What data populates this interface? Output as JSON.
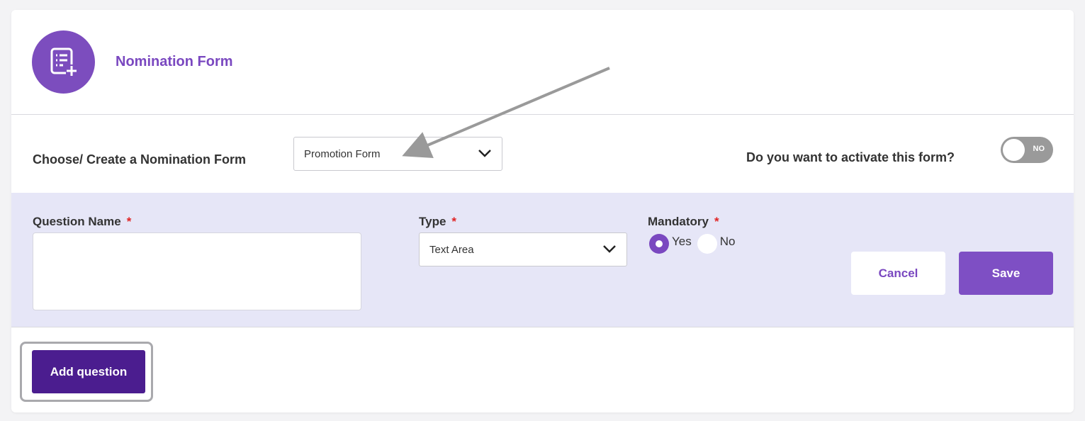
{
  "header": {
    "title": "Nomination Form",
    "icon": "form-add-icon"
  },
  "choose": {
    "label": "Choose/ Create a Nomination Form",
    "selected": "Promotion Form"
  },
  "activate": {
    "label": "Do you want to activate this form?",
    "toggle_text": "NO",
    "active": false
  },
  "question": {
    "name_label": "Question Name",
    "name_value": "",
    "type_label": "Type",
    "type_selected": "Text Area",
    "mandatory_label": "Mandatory",
    "required_marker": "*",
    "options": [
      {
        "label": "Yes",
        "checked": true
      },
      {
        "label": "No",
        "checked": false
      }
    ],
    "cancel_label": "Cancel",
    "save_label": "Save"
  },
  "footer": {
    "add_label": "Add question"
  },
  "colors": {
    "accent": "#7a48c0",
    "dark_accent": "#4b1d8f",
    "panel": "#e6e6f7"
  }
}
